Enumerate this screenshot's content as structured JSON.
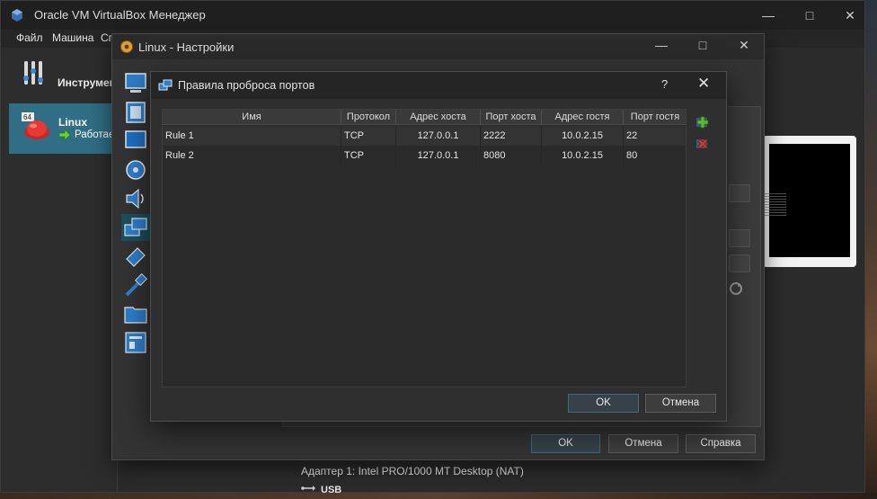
{
  "manager": {
    "title": "Oracle VM VirtualBox Менеджер",
    "menu": [
      "Файл",
      "Машина",
      "Сп"
    ],
    "tools_label": "Инструмент",
    "vm": {
      "name": "Linux",
      "state": "Работае",
      "badge": "64"
    },
    "details": {
      "adapter": "Адаптер 1:   Intel PRO/1000 MT Desktop (NAT)",
      "usb": "USB"
    }
  },
  "settings": {
    "title": "Linux - Настройки",
    "buttons": {
      "ok": "OK",
      "cancel": "Отмена",
      "help": "Справка"
    }
  },
  "port_forwarding": {
    "title": "Правила проброса портов",
    "help_glyph": "?",
    "close_glyph": "✕",
    "columns": [
      "Имя",
      "Протокол",
      "Адрес хоста",
      "Порт хоста",
      "Адрес гостя",
      "Порт гостя"
    ],
    "rows": [
      [
        "Rule 1",
        "TCP",
        "127.0.0.1",
        "2222",
        "10.0.2.15",
        "22"
      ],
      [
        "Rule 2",
        "TCP",
        "127.0.0.1",
        "8080",
        "10.0.2.15",
        "80"
      ]
    ],
    "buttons": {
      "ok": "OK",
      "cancel": "Отмена"
    },
    "side_actions": [
      "add-rule-icon",
      "remove-rule-icon"
    ]
  },
  "colors": {
    "selection": "#2f6e84",
    "accent_add": "#5fb83a",
    "accent_remove": "#d23b2b"
  }
}
